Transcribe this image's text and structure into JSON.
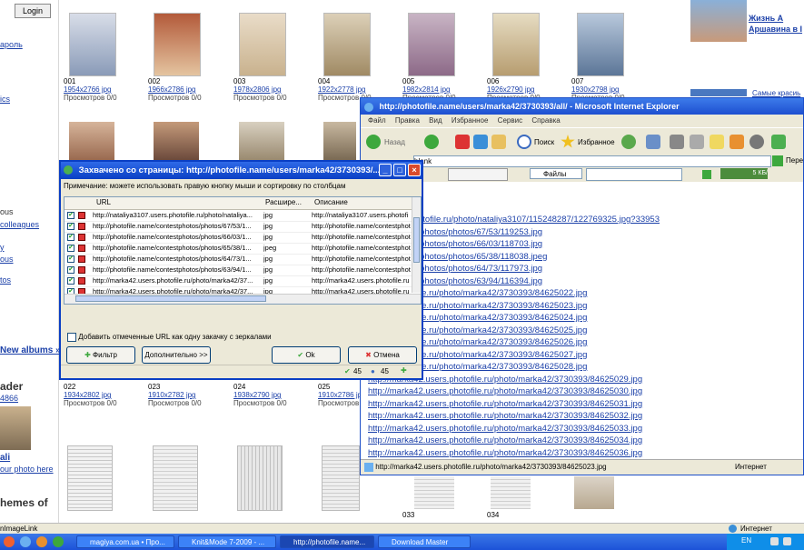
{
  "bg_page": {
    "login_label": "Login",
    "left_links": [
      "ароль",
      "ics",
      "ous",
      "colleagues",
      "y",
      "ous",
      "tos"
    ],
    "new_albums": "New albums »",
    "leader_title": "ader",
    "leader_count": "4866",
    "leader_name": "ali",
    "leader_link": "our photo here",
    "themes_title": "hemes of",
    "image_link": "nImageLink",
    "top_right_link": "Жизнь А\nАршавина в I",
    "top_right_link2": "Самые красиь",
    "thumbs_row1": [
      {
        "num": "001",
        "res": "1954x2766 jpg",
        "views": "Просмотров 0/0"
      },
      {
        "num": "002",
        "res": "1966x2786 jpg",
        "views": "Просмотров 0/0"
      },
      {
        "num": "003",
        "res": "1978x2806 jpg",
        "views": "Просмотров 0/0"
      },
      {
        "num": "004",
        "res": "1922x2778 jpg",
        "views": "Просмотров 0/0"
      },
      {
        "num": "005",
        "res": "1982x2814 jpg",
        "views": "Просмотров 0/0"
      },
      {
        "num": "006",
        "res": "1926x2790 jpg",
        "views": "Просмотров 0/0"
      },
      {
        "num": "007",
        "res": "1930x2798 jpg",
        "views": "Просмотров 0/0"
      }
    ],
    "thumbs_row3": [
      {
        "num": "022",
        "res": "1934x2802 jpg",
        "views": "Просмотров 0/0"
      },
      {
        "num": "023",
        "res": "1910x2782 jpg",
        "views": "Просмотров 0/0"
      },
      {
        "num": "024",
        "res": "1938x2790 jpg",
        "views": "Просмотров 0/0"
      },
      {
        "num": "025",
        "res": "1910x2786 jpg",
        "views": "Просмотров 0/0"
      }
    ],
    "bottom_nums": [
      "033",
      "034"
    ]
  },
  "ie": {
    "title": "http://photofile.name/users/marka42/3730393/all/ - Microsoft Internet Explorer",
    "menu": [
      "Файл",
      "Правка",
      "Вид",
      "Избранное",
      "Сервис",
      "Справка"
    ],
    "back_label": "Назад",
    "search_label": "Поиск",
    "favorites_label": "Избранное",
    "address_value": "blank",
    "go_label": "Пере",
    "files_label": "Файлы",
    "speed_label": "5 КБ/",
    "links": [
      "107.users.photofile.ru/photo/nataliya3107/115248287/122769325.jpg?33953",
      "name/contestphotos/photos/67/53/119253.jpg",
      "name/contestphotos/photos/66/03/118703.jpg",
      "name/contestphotos/photos/65/38/118038.jpeg",
      "name/contestphotos/photos/64/73/117973.jpg",
      "name/contestphotos/photos/63/94/116394.jpg",
      ".users.photofile.ru/photo/marka42/3730393/84625022.jpg",
      ".users.photofile.ru/photo/marka42/3730393/84625023.jpg",
      ".users.photofile.ru/photo/marka42/3730393/84625024.jpg",
      ".users.photofile.ru/photo/marka42/3730393/84625025.jpg",
      ".users.photofile.ru/photo/marka42/3730393/84625026.jpg",
      ".users.photofile.ru/photo/marka42/3730393/84625027.jpg",
      ".users.photofile.ru/photo/marka42/3730393/84625028.jpg",
      "http://marka42.users.photofile.ru/photo/marka42/3730393/84625029.jpg",
      "http://marka42.users.photofile.ru/photo/marka42/3730393/84625030.jpg",
      "http://marka42.users.photofile.ru/photo/marka42/3730393/84625031.jpg",
      "http://marka42.users.photofile.ru/photo/marka42/3730393/84625032.jpg",
      "http://marka42.users.photofile.ru/photo/marka42/3730393/84625033.jpg",
      "http://marka42.users.photofile.ru/photo/marka42/3730393/84625034.jpg",
      "http://marka42.users.photofile.ru/photo/marka42/3730393/84625036.jpg"
    ],
    "status_url": "http://marka42.users.photofile.ru/photo/marka42/3730393/84625023.jpg",
    "status_zone": "Интернет"
  },
  "dialog": {
    "title": "Захвачено со страницы: http://photofile.name/users/marka42/3730393/...",
    "note": "Примечание: можете использовать правую кнопку мыши и сортировку по столбцам",
    "col_url": "URL",
    "col_ext": "Расшире...",
    "col_desc": "Описание",
    "rows": [
      {
        "url": "http://nataliya3107.users.photofile.ru/photo/nataliya...",
        "ext": "jpg",
        "desc": "http://nataliya3107.users.photofi"
      },
      {
        "url": "http://photofile.name/contestphotos/photos/67/53/1...",
        "ext": "jpg",
        "desc": "http://photofile.name/contestphot"
      },
      {
        "url": "http://photofile.name/contestphotos/photos/66/03/1...",
        "ext": "jpg",
        "desc": "http://photofile.name/contestphot"
      },
      {
        "url": "http://photofile.name/contestphotos/photos/65/38/1...",
        "ext": "jpeg",
        "desc": "http://photofile.name/contestphot"
      },
      {
        "url": "http://photofile.name/contestphotos/photos/64/73/1...",
        "ext": "jpg",
        "desc": "http://photofile.name/contestphot"
      },
      {
        "url": "http://photofile.name/contestphotos/photos/63/94/1...",
        "ext": "jpg",
        "desc": "http://photofile.name/contestphot"
      },
      {
        "url": "http://marka42.users.photofile.ru/photo/marka42/37...",
        "ext": "jpg",
        "desc": "http://marka42.users.photofile.ru"
      },
      {
        "url": "http://marka42.users.photofile.ru/photo/marka42/37...",
        "ext": "jpg",
        "desc": "http://marka42.users.photofile.ru"
      },
      {
        "url": "http://marka42.users.photofile.ru/photo/marka42/37...",
        "ext": "jpg",
        "desc": "http://marka42.users.photofile.ru"
      },
      {
        "url": "http://marka42.users.photofile.ru/photo/marka42/37...",
        "ext": "jpg",
        "desc": "http://marka42.users.photofile.ru"
      }
    ],
    "mirrors_checkbox": "Добавить отмеченные URL как одну закачку с зеркалами",
    "filter_label": "Фильтр",
    "more_label": "Дополнительно >>",
    "ok_label": "Ok",
    "cancel_label": "Отмена",
    "count_checked": "45",
    "count_total": "45"
  },
  "taskbar": {
    "tasks": [
      {
        "label": "magiya.com.ua • Про..."
      },
      {
        "label": "Knit&Mode 7-2009 - ..."
      },
      {
        "label": "http://photofile.name..."
      },
      {
        "label": "Download Master"
      }
    ],
    "lang": "EN",
    "clock": "",
    "zone": "Интернет"
  },
  "colors": {
    "accent": "#1c4fc8",
    "link": "#1a3fa8",
    "window_bg": "#ece9d8"
  }
}
